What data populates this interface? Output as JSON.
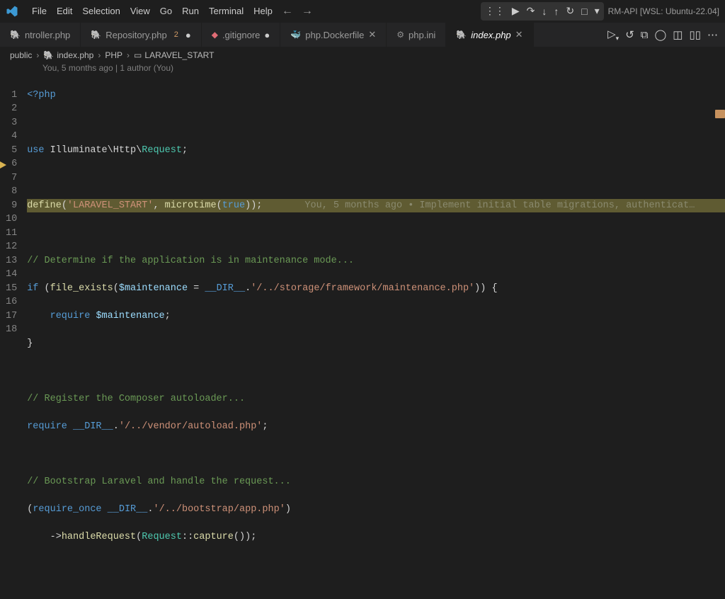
{
  "window": {
    "title": "RM-API [WSL: Ubuntu-22.04]"
  },
  "menubar": [
    "File",
    "Edit",
    "Selection",
    "View",
    "Go",
    "Run",
    "Terminal",
    "Help"
  ],
  "tabs": [
    {
      "icon": "php",
      "label": "ntroller.php",
      "badge": "",
      "active": false,
      "modified": false,
      "close": false
    },
    {
      "icon": "php",
      "label": "Repository.php",
      "badge": "2",
      "active": false,
      "modified": true,
      "close": false
    },
    {
      "icon": "git",
      "label": ".gitignore",
      "badge": "",
      "active": false,
      "modified": true,
      "close": false
    },
    {
      "icon": "docker",
      "label": "php.Dockerfile",
      "badge": "",
      "active": false,
      "modified": false,
      "close": true
    },
    {
      "icon": "cfg",
      "label": "php.ini",
      "badge": "",
      "active": false,
      "modified": false,
      "close": false
    },
    {
      "icon": "php",
      "label": "index.php",
      "badge": "",
      "active": true,
      "modified": false,
      "close": true
    }
  ],
  "breadcrumb": {
    "root": "public",
    "file": "index.php",
    "sym1": "PHP",
    "sym2": "LARAVEL_START"
  },
  "gitlens": {
    "header": "You, 5 months ago | 1 author (You)",
    "line_blame": "You, 5 months ago • Implement initial table migrations, authenticat…"
  },
  "lines": {
    "count": 18,
    "l1": "<?php",
    "l3_use": "use",
    "l3_ns": " Illuminate\\Http\\",
    "l3_cls": "Request",
    "l3_end": ";",
    "l5_fn": "define",
    "l5_s": "'LARAVEL_START'",
    "l5_fn2": "microtime",
    "l5_b": "true",
    "l7": "// Determine if the application is in maintenance mode...",
    "l8_if": "if",
    "l8_fn": "file_exists",
    "l8_v": "$maintenance",
    "l8_dir": "__DIR__",
    "l8_s": "'/../storage/framework/maintenance.php'",
    "l9_req": "require",
    "l9_v": "$maintenance",
    "l12": "// Register the Composer autoloader...",
    "l13_req": "require",
    "l13_dir": "__DIR__",
    "l13_s": "'/../vendor/autoload.php'",
    "l15": "// Bootstrap Laravel and handle the request...",
    "l16_req": "require_once",
    "l16_dir": "__DIR__",
    "l16_s": "'/../bootstrap/app.php'",
    "l17_fn": "handleRequest",
    "l17_cls": "Request",
    "l17_fn2": "capture"
  }
}
